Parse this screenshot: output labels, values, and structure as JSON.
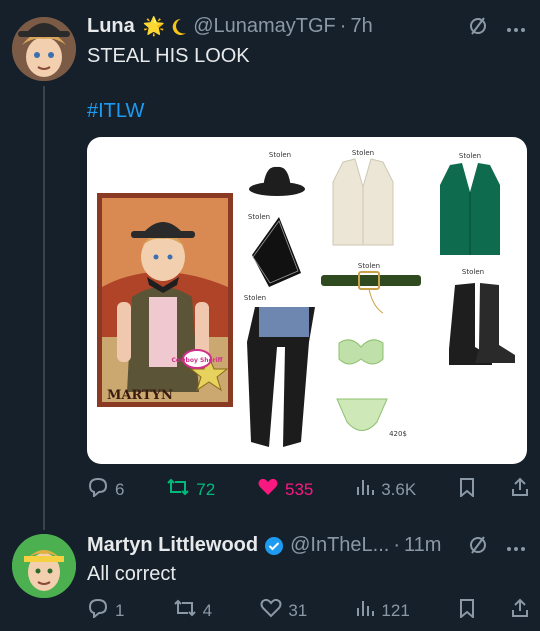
{
  "tweet1": {
    "author_name": "Luna",
    "author_emoji": "🌟",
    "handle": "@LunamayTGF",
    "separator": "·",
    "time": "7h",
    "text": "STEAL HIS LOOK",
    "hashtag": "#ITLW",
    "media": {
      "poster_label": "MARTYN",
      "badge_text": "Cowboy Sheriff",
      "stolen_labels": [
        "Stolen",
        "Stolen",
        "Stolen",
        "Stolen",
        "Stolen",
        "Stolen",
        "Stolen"
      ],
      "price": "420$"
    },
    "actions": {
      "replies": "6",
      "retweets": "72",
      "likes": "535",
      "views": "3.6K"
    }
  },
  "tweet2": {
    "author_name": "Martyn Littlewood",
    "handle": "@InTheL...",
    "separator": "·",
    "time": "11m",
    "text": "All correct",
    "actions": {
      "replies": "1",
      "retweets": "4",
      "likes": "31",
      "views": "121"
    }
  },
  "colors": {
    "background": "#15202b",
    "accent": "#1d9bf0",
    "retweet": "#00ba7c",
    "like": "#f91880",
    "muted": "#8b98a5"
  }
}
